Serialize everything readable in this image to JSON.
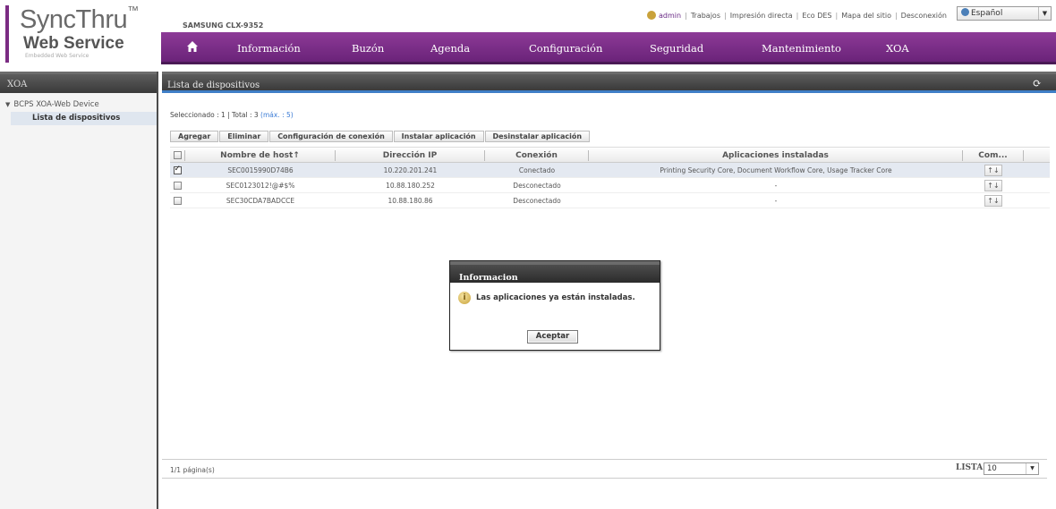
{
  "header": {
    "logo_title": "SyncThru",
    "logo_tm": "™",
    "logo_subtitle": "Web Service",
    "logo_tagline": "Embedded Web Service",
    "model": "SAMSUNG CLX-9352",
    "top_links": [
      "admin",
      "Trabajos",
      "Impresión directa",
      "Eco DES",
      "Mapa del sitio",
      "Desconexión"
    ],
    "language": "Español"
  },
  "nav": {
    "home_icon": "home-icon",
    "items": [
      "Información",
      "Buzón",
      "Agenda",
      "Configuración",
      "Seguridad",
      "Mantenimiento",
      "XOA"
    ],
    "accent_color": "#7b2c83"
  },
  "sidebar": {
    "title": "XOA",
    "tree_root": "BCPS XOA-Web Device",
    "tree_leaf": "Lista de dispositivos"
  },
  "main": {
    "title": "Lista de dispositivos",
    "selection": {
      "text": "Seleccionado : 1 | Total : 3",
      "max": "(máx. : 5)"
    },
    "toolbar": [
      "Agregar",
      "Eliminar",
      "Configuración de conexión",
      "Instalar aplicación",
      "Desinstalar aplicación"
    ],
    "columns": {
      "hostname": "Nombre de host↑",
      "ip": "Dirección IP",
      "connection": "Conexión",
      "apps": "Aplicaciones instaladas",
      "command": "Com..."
    },
    "rows": [
      {
        "checked": true,
        "hostname": "SEC0015990D74B6",
        "ip": "10.220.201.241",
        "connection": "Conectado",
        "apps": "Printing Security Core, Document Workflow Core, Usage Tracker Core",
        "cmd": "↑↓"
      },
      {
        "checked": false,
        "hostname": "SEC0123012!@#$%",
        "ip": "10.88.180.252",
        "connection": "Desconectado",
        "apps": "-",
        "cmd": "↑↓"
      },
      {
        "checked": false,
        "hostname": "SEC30CDA7BADCCE",
        "ip": "10.88.180.86",
        "connection": "Desconectado",
        "apps": "-",
        "cmd": "↑↓"
      }
    ],
    "footer": {
      "page_info": "1/1 página(s)",
      "list_label": "LISTA",
      "list_value": "10"
    }
  },
  "modal": {
    "title": "Informacion",
    "message": "Las aplicaciones ya están instaladas.",
    "ok_label": "Aceptar",
    "icon": "info-icon"
  }
}
